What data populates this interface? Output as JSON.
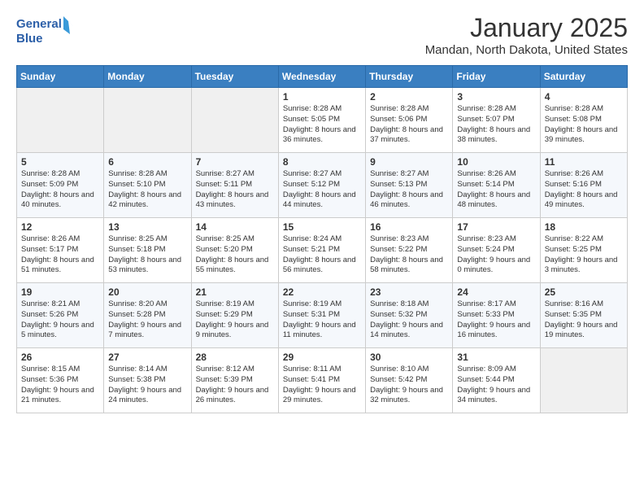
{
  "header": {
    "logo_line1": "General",
    "logo_line2": "Blue",
    "month": "January 2025",
    "location": "Mandan, North Dakota, United States"
  },
  "weekdays": [
    "Sunday",
    "Monday",
    "Tuesday",
    "Wednesday",
    "Thursday",
    "Friday",
    "Saturday"
  ],
  "weeks": [
    [
      {
        "day": "",
        "empty": true
      },
      {
        "day": "",
        "empty": true
      },
      {
        "day": "",
        "empty": true
      },
      {
        "day": "1",
        "rise": "8:28 AM",
        "set": "5:05 PM",
        "daylight": "8 hours and 36 minutes."
      },
      {
        "day": "2",
        "rise": "8:28 AM",
        "set": "5:06 PM",
        "daylight": "8 hours and 37 minutes."
      },
      {
        "day": "3",
        "rise": "8:28 AM",
        "set": "5:07 PM",
        "daylight": "8 hours and 38 minutes."
      },
      {
        "day": "4",
        "rise": "8:28 AM",
        "set": "5:08 PM",
        "daylight": "8 hours and 39 minutes."
      }
    ],
    [
      {
        "day": "5",
        "rise": "8:28 AM",
        "set": "5:09 PM",
        "daylight": "8 hours and 40 minutes."
      },
      {
        "day": "6",
        "rise": "8:28 AM",
        "set": "5:10 PM",
        "daylight": "8 hours and 42 minutes."
      },
      {
        "day": "7",
        "rise": "8:27 AM",
        "set": "5:11 PM",
        "daylight": "8 hours and 43 minutes."
      },
      {
        "day": "8",
        "rise": "8:27 AM",
        "set": "5:12 PM",
        "daylight": "8 hours and 44 minutes."
      },
      {
        "day": "9",
        "rise": "8:27 AM",
        "set": "5:13 PM",
        "daylight": "8 hours and 46 minutes."
      },
      {
        "day": "10",
        "rise": "8:26 AM",
        "set": "5:14 PM",
        "daylight": "8 hours and 48 minutes."
      },
      {
        "day": "11",
        "rise": "8:26 AM",
        "set": "5:16 PM",
        "daylight": "8 hours and 49 minutes."
      }
    ],
    [
      {
        "day": "12",
        "rise": "8:26 AM",
        "set": "5:17 PM",
        "daylight": "8 hours and 51 minutes."
      },
      {
        "day": "13",
        "rise": "8:25 AM",
        "set": "5:18 PM",
        "daylight": "8 hours and 53 minutes."
      },
      {
        "day": "14",
        "rise": "8:25 AM",
        "set": "5:20 PM",
        "daylight": "8 hours and 55 minutes."
      },
      {
        "day": "15",
        "rise": "8:24 AM",
        "set": "5:21 PM",
        "daylight": "8 hours and 56 minutes."
      },
      {
        "day": "16",
        "rise": "8:23 AM",
        "set": "5:22 PM",
        "daylight": "8 hours and 58 minutes."
      },
      {
        "day": "17",
        "rise": "8:23 AM",
        "set": "5:24 PM",
        "daylight": "9 hours and 0 minutes."
      },
      {
        "day": "18",
        "rise": "8:22 AM",
        "set": "5:25 PM",
        "daylight": "9 hours and 3 minutes."
      }
    ],
    [
      {
        "day": "19",
        "rise": "8:21 AM",
        "set": "5:26 PM",
        "daylight": "9 hours and 5 minutes."
      },
      {
        "day": "20",
        "rise": "8:20 AM",
        "set": "5:28 PM",
        "daylight": "9 hours and 7 minutes."
      },
      {
        "day": "21",
        "rise": "8:19 AM",
        "set": "5:29 PM",
        "daylight": "9 hours and 9 minutes."
      },
      {
        "day": "22",
        "rise": "8:19 AM",
        "set": "5:31 PM",
        "daylight": "9 hours and 11 minutes."
      },
      {
        "day": "23",
        "rise": "8:18 AM",
        "set": "5:32 PM",
        "daylight": "9 hours and 14 minutes."
      },
      {
        "day": "24",
        "rise": "8:17 AM",
        "set": "5:33 PM",
        "daylight": "9 hours and 16 minutes."
      },
      {
        "day": "25",
        "rise": "8:16 AM",
        "set": "5:35 PM",
        "daylight": "9 hours and 19 minutes."
      }
    ],
    [
      {
        "day": "26",
        "rise": "8:15 AM",
        "set": "5:36 PM",
        "daylight": "9 hours and 21 minutes."
      },
      {
        "day": "27",
        "rise": "8:14 AM",
        "set": "5:38 PM",
        "daylight": "9 hours and 24 minutes."
      },
      {
        "day": "28",
        "rise": "8:12 AM",
        "set": "5:39 PM",
        "daylight": "9 hours and 26 minutes."
      },
      {
        "day": "29",
        "rise": "8:11 AM",
        "set": "5:41 PM",
        "daylight": "9 hours and 29 minutes."
      },
      {
        "day": "30",
        "rise": "8:10 AM",
        "set": "5:42 PM",
        "daylight": "9 hours and 32 minutes."
      },
      {
        "day": "31",
        "rise": "8:09 AM",
        "set": "5:44 PM",
        "daylight": "9 hours and 34 minutes."
      },
      {
        "day": "",
        "empty": true
      }
    ]
  ]
}
